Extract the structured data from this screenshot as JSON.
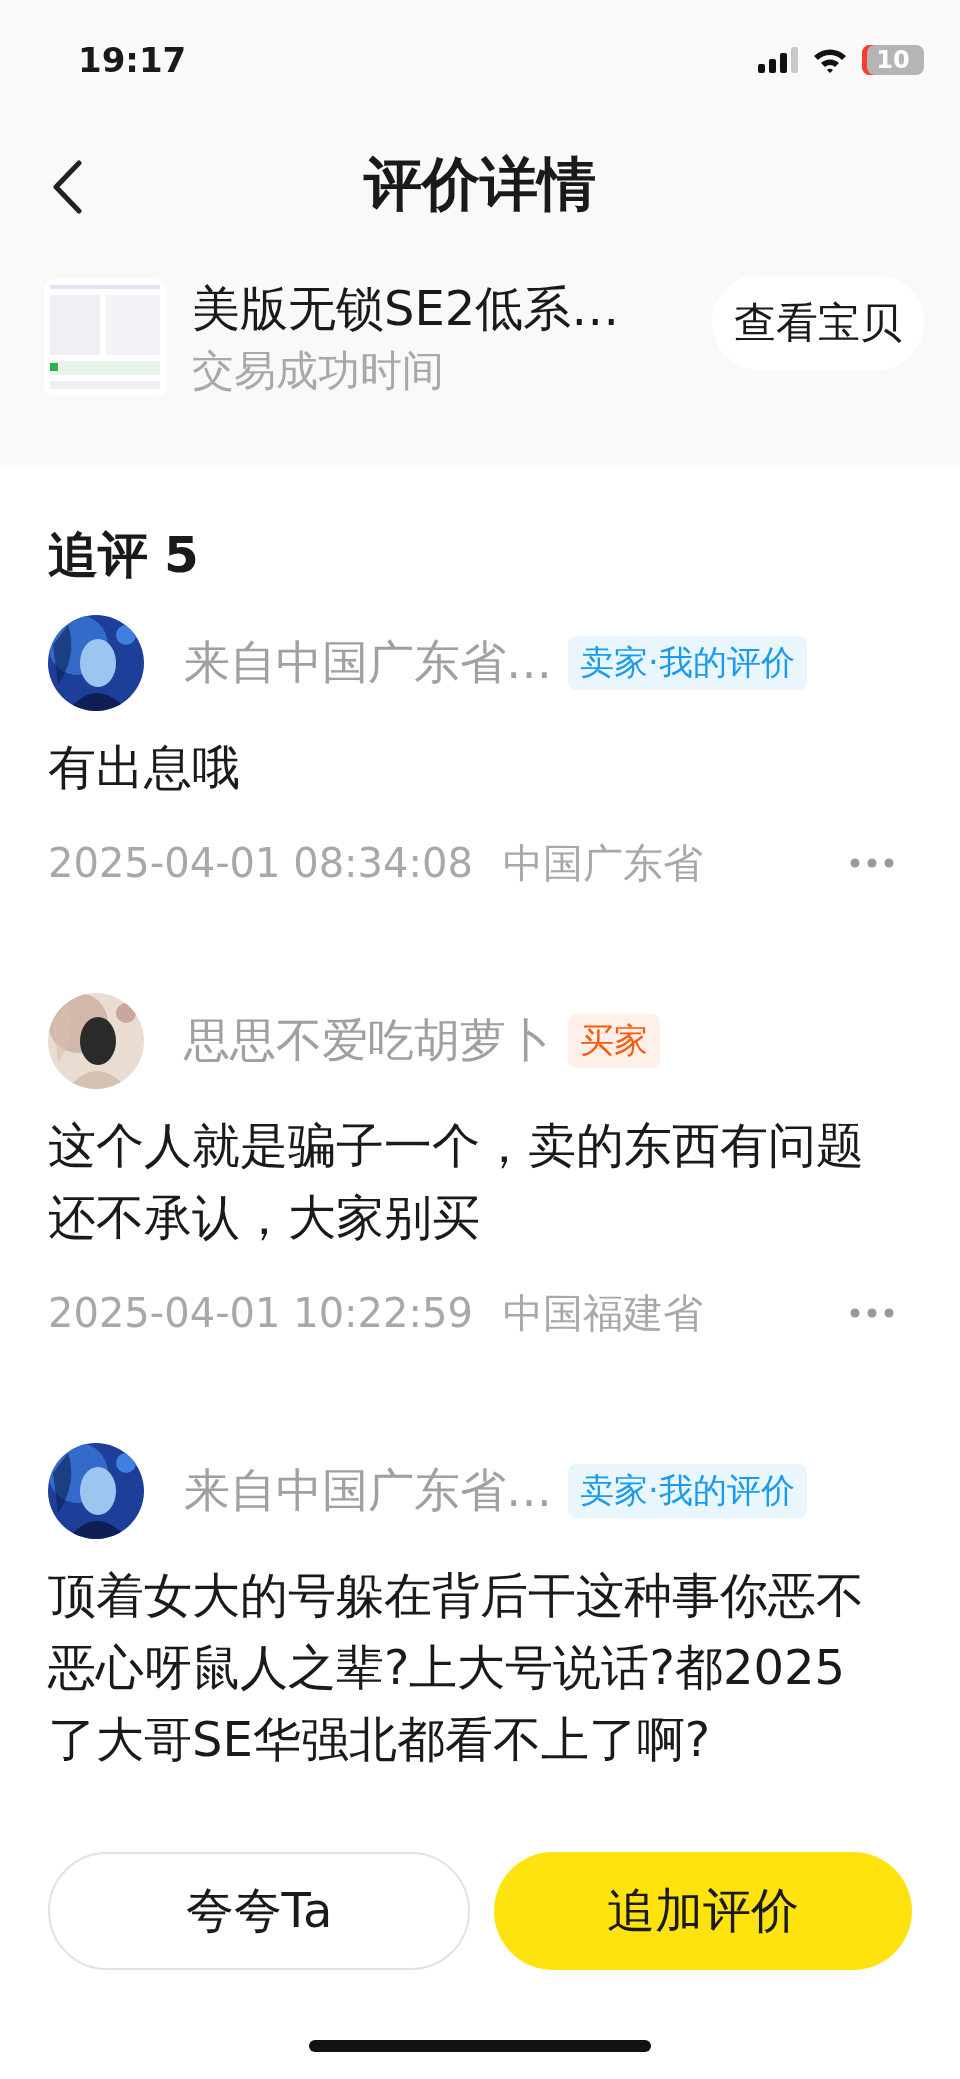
{
  "status_bar": {
    "time": "19:17",
    "battery": "10"
  },
  "header": {
    "title": "评价详情"
  },
  "product": {
    "title": "美版无锁SE2低系…",
    "subtitle": "交易成功时间",
    "button": "查看宝贝"
  },
  "section": {
    "title": "追评",
    "count": "5"
  },
  "reviews": [
    {
      "name": "来自中国广东省…",
      "badge": {
        "kind": "seller",
        "text": "卖家·我的评价"
      },
      "body": "有出息哦",
      "time": "2025-04-01 08:34:08",
      "location": "中国广东省"
    },
    {
      "name": "思思不爱吃胡萝卜",
      "badge": {
        "kind": "buyer",
        "text": "买家"
      },
      "body": "这个人就是骗子一个，卖的东西有问题还不承认，大家别买",
      "time": "2025-04-01 10:22:59",
      "location": "中国福建省"
    },
    {
      "name": "来自中国广东省…",
      "badge": {
        "kind": "seller",
        "text": "卖家·我的评价"
      },
      "body": "顶着女大的号躲在背后干这种事你恶不恶心呀鼠人之辈?上大号说话?都2025了大哥SE华强北都看不上了啊?"
    }
  ],
  "actions": {
    "secondary": "夸夸Ta",
    "primary": "追加评价"
  }
}
